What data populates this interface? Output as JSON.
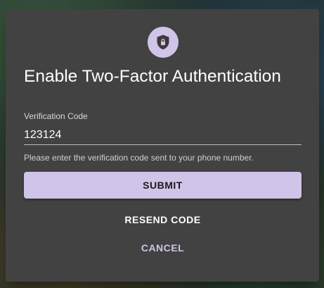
{
  "dialog": {
    "title": "Enable Two-Factor Authentication",
    "icon": "shield-lock-icon",
    "field": {
      "label": "Verification Code",
      "value": "123124",
      "helper": "Please enter the verification code sent to your phone number."
    },
    "buttons": {
      "submit": "SUBMIT",
      "resend": "RESEND CODE",
      "cancel": "CANCEL"
    }
  },
  "colors": {
    "surface": "#424242",
    "accent": "#d1c4e9",
    "text": "#ffffff"
  }
}
